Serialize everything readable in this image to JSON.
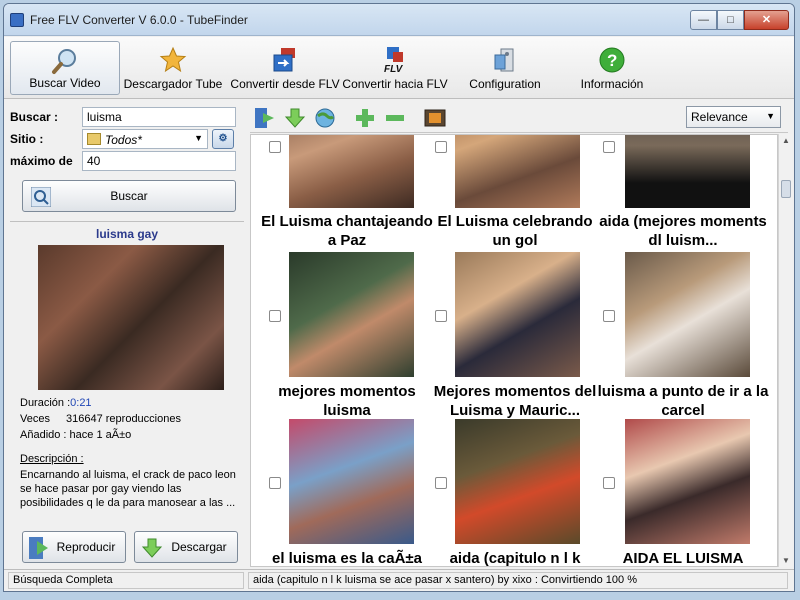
{
  "window": {
    "title": "Free FLV Converter V 6.0.0 - TubeFinder",
    "minimize_label": "—",
    "maximize_label": "□",
    "close_label": "✕"
  },
  "toolbar": {
    "items": [
      {
        "label": "Buscar Video",
        "icon": "magnifier-icon"
      },
      {
        "label": "Descargador Tube",
        "icon": "star-icon"
      },
      {
        "label": "Convertir desde FLV",
        "icon": "convert-from-flv-icon"
      },
      {
        "label": "Convertir hacia FLV",
        "icon": "convert-to-flv-icon"
      },
      {
        "label": "Configuration",
        "icon": "settings-icon"
      },
      {
        "label": "Información",
        "icon": "help-icon"
      }
    ]
  },
  "search": {
    "buscar_label": "Buscar :",
    "buscar_value": "luisma",
    "sitio_label": "Sitio :",
    "sitio_value": "Todos*",
    "maximo_label": "máximo de",
    "maximo_value": "40",
    "buscar_button": "Buscar"
  },
  "preview": {
    "title": "luisma gay",
    "duracion_label": "Duración :",
    "duracion_value": "0:21",
    "veces_label": "Veces",
    "veces_value": "316647 reproducciones",
    "anadido_label": "Añadido : hace 1 aÃ±o",
    "descripcion_label": "Descripción :",
    "descripcion_text": "Encarnando al luisma, el crack de paco leon se hace pasar por gay viendo las posibilidades q le da para manosear a las ...",
    "reproducir_button": "Reproducir",
    "descargar_button": "Descargar"
  },
  "results_toolbar": {
    "sort_value": "Relevance"
  },
  "results": [
    {
      "title": "El Luisma chantajeando a Paz"
    },
    {
      "title": "El Luisma celebrando un gol"
    },
    {
      "title": "aida (mejores moments dl luism..."
    },
    {
      "title": "mejores momentos luisma"
    },
    {
      "title": "Mejores momentos del Luisma y Mauric..."
    },
    {
      "title": "luisma a punto de ir a la carcel"
    },
    {
      "title": "el luisma es la caÃ±a"
    },
    {
      "title": "aida (capitulo n l k"
    },
    {
      "title": "AIDA   EL LUISMA"
    }
  ],
  "status": {
    "left": "Búsqueda Completa",
    "right": "aida (capitulo n l k luisma se ace pasar x santero) by xixo : Convirtiendo  100 %"
  }
}
